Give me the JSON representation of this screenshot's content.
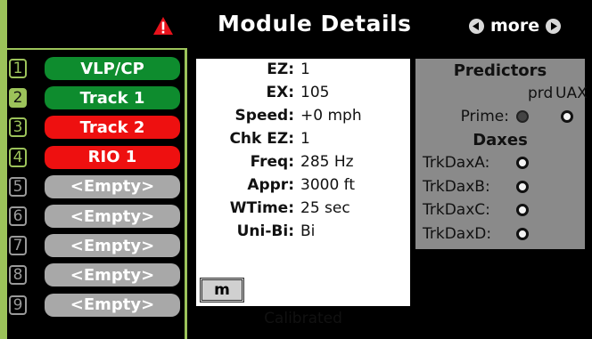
{
  "header": {
    "title": "Module Details",
    "more_label": "more",
    "warning_icon": "warning-triangle-icon",
    "accent_color": "#9cc35a"
  },
  "slots": [
    {
      "num": "1",
      "label": "VLP/CP",
      "color": "green",
      "state": "ghost"
    },
    {
      "num": "2",
      "label": "Track 1",
      "color": "green",
      "state": "active"
    },
    {
      "num": "3",
      "label": "Track 2",
      "color": "red",
      "state": "ghost"
    },
    {
      "num": "4",
      "label": "RIO 1",
      "color": "red",
      "state": "ghost"
    },
    {
      "num": "5",
      "label": "<Empty>",
      "color": "gray",
      "state": "empty"
    },
    {
      "num": "6",
      "label": "<Empty>",
      "color": "gray",
      "state": "empty"
    },
    {
      "num": "7",
      "label": "<Empty>",
      "color": "gray",
      "state": "empty"
    },
    {
      "num": "8",
      "label": "<Empty>",
      "color": "gray",
      "state": "empty"
    },
    {
      "num": "9",
      "label": "<Empty>",
      "color": "gray",
      "state": "empty"
    }
  ],
  "details": {
    "rows": [
      {
        "label": "EZ:",
        "value": "1"
      },
      {
        "label": "EX:",
        "value": "105"
      },
      {
        "label": "Speed:",
        "value": "+0 mph"
      },
      {
        "label": "Chk EZ:",
        "value": "1"
      },
      {
        "label": "Freq:",
        "value": "285 Hz"
      },
      {
        "label": "Appr:",
        "value": "3000 ft"
      },
      {
        "label": "WTime:",
        "value": "25 sec"
      },
      {
        "label": "Uni-Bi:",
        "value": "Bi"
      }
    ],
    "status": "Calibrated",
    "m_button": "m"
  },
  "predictors": {
    "title": "Predictors",
    "col_prd": "prd",
    "col_uax": "UAX",
    "prime_label": "Prime:",
    "daxes_title": "Daxes",
    "daxes": [
      {
        "label": "TrkDaxA:"
      },
      {
        "label": "TrkDaxB:"
      },
      {
        "label": "TrkDaxC:"
      },
      {
        "label": "TrkDaxD:"
      }
    ]
  }
}
